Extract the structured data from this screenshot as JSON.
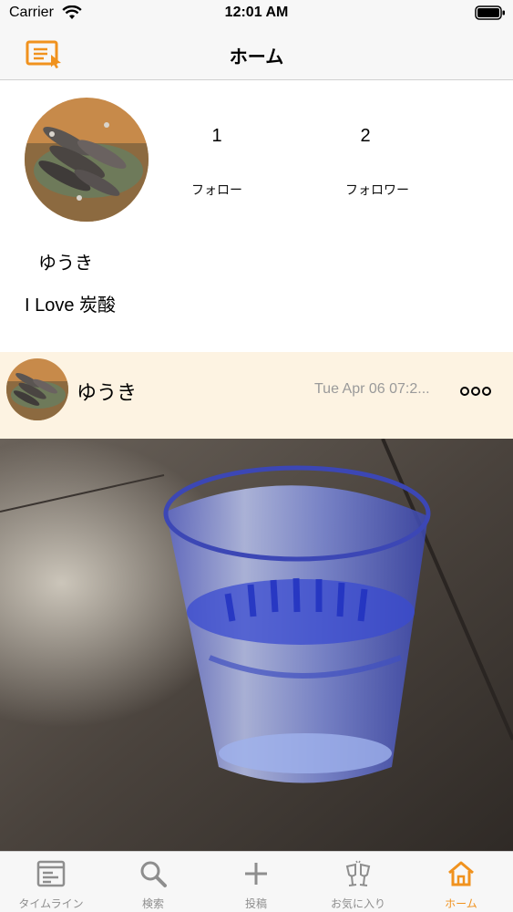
{
  "status_bar": {
    "carrier": "Carrier",
    "time": "12:01 AM"
  },
  "nav": {
    "title": "ホーム",
    "edit_icon": "edit-list-icon"
  },
  "profile": {
    "name": "ゆうき",
    "bio": "I Love 炭酸",
    "follow_count": "1",
    "follow_label": "フォロー",
    "follower_count": "2",
    "follower_label": "フォロワー"
  },
  "post": {
    "user": "ゆうき",
    "timestamp": "Tue Apr 06 07:2...",
    "more_icon": "more-dots-icon"
  },
  "tabs": [
    {
      "label": "タイムライン",
      "icon": "timeline-icon",
      "active": false
    },
    {
      "label": "検索",
      "icon": "search-icon",
      "active": false
    },
    {
      "label": "投稿",
      "icon": "plus-icon",
      "active": false
    },
    {
      "label": "お気に入り",
      "icon": "cheers-glasses-icon",
      "active": false
    },
    {
      "label": "ホーム",
      "icon": "home-icon",
      "active": true
    }
  ],
  "colors": {
    "accent": "#f0921e",
    "post_header_bg": "#fdf3e2",
    "bar_bg": "#f7f7f7",
    "inactive_tab": "#8e8e8e"
  }
}
